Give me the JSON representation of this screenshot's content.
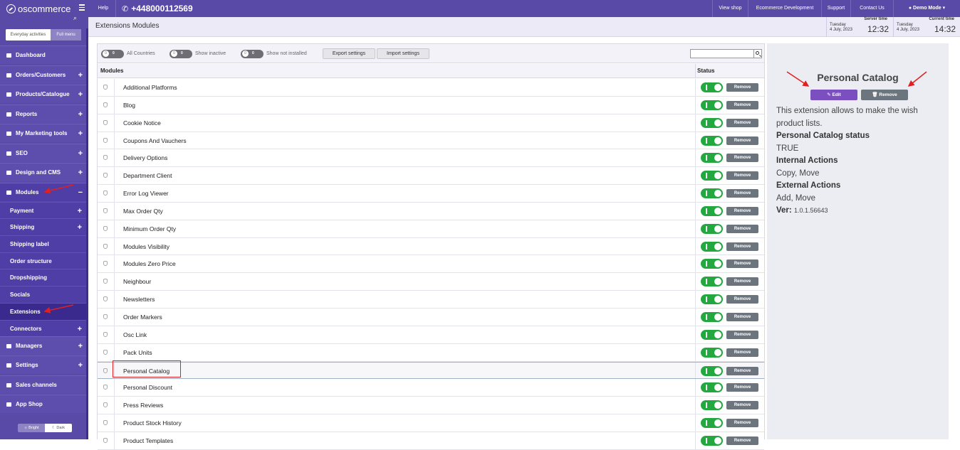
{
  "app": {
    "logo_text": "oscommerce"
  },
  "sidebar": {
    "modes": [
      "Everyday activities",
      "Full menu"
    ],
    "items": [
      {
        "label": "Dashboard",
        "icon": "dashboard-icon",
        "expand": ""
      },
      {
        "label": "Orders/Customers",
        "icon": "orders-icon",
        "expand": "+"
      },
      {
        "label": "Products/Catalogue",
        "icon": "catalogue-icon",
        "expand": "+"
      },
      {
        "label": "Reports",
        "icon": "reports-icon",
        "expand": "+"
      },
      {
        "label": "My Marketing tools",
        "icon": "marketing-icon",
        "expand": "+"
      },
      {
        "label": "SEO",
        "icon": "seo-icon",
        "expand": "+"
      },
      {
        "label": "Design and CMS",
        "icon": "design-icon",
        "expand": "+"
      },
      {
        "label": "Modules",
        "icon": "modules-icon",
        "expand": "−"
      }
    ],
    "subitems": [
      {
        "label": "Payment",
        "expand": "+"
      },
      {
        "label": "Shipping",
        "expand": "+"
      },
      {
        "label": "Shipping label",
        "expand": ""
      },
      {
        "label": "Order structure",
        "expand": ""
      },
      {
        "label": "Dropshipping",
        "expand": ""
      },
      {
        "label": "Socials",
        "expand": ""
      },
      {
        "label": "Extensions",
        "expand": ""
      },
      {
        "label": "Connectors",
        "expand": "+"
      }
    ],
    "bottom_items": [
      {
        "label": "Managers",
        "icon": "managers-icon",
        "expand": "+"
      },
      {
        "label": "Settings",
        "icon": "settings-icon",
        "expand": "+"
      },
      {
        "label": "Sales channels",
        "icon": "sales-channels-icon",
        "expand": ""
      },
      {
        "label": "App Shop",
        "icon": "app-shop-icon",
        "expand": ""
      }
    ],
    "theme": {
      "bright": "Bright",
      "dark": "Dark"
    }
  },
  "topbar": {
    "help": "Help",
    "phone": "+448000112569",
    "links": [
      "View shop",
      "Ecommerce Development",
      "Support",
      "Contact Us"
    ],
    "user": "Demo Mode"
  },
  "header": {
    "title": "Extensions Modules",
    "server_time": {
      "caption": "Server time",
      "day": "Tuesday",
      "date": "4 July, 2023",
      "time": "12:32"
    },
    "current_time": {
      "caption": "Current time",
      "day": "Tuesday",
      "date": "4 July, 2023",
      "time": "14:32"
    }
  },
  "filters": {
    "toggles": [
      "All Countries",
      "Show inactive",
      "Show not installed"
    ],
    "buttons": [
      "Export settings",
      "Import settings"
    ],
    "search_value": ""
  },
  "table": {
    "headers": [
      "Modules",
      "Status"
    ],
    "remove_label": "Remove",
    "selected": "Personal Catalog",
    "rows": [
      "Additional Platforms",
      "Blog",
      "Cookie Notice",
      "Coupons And Vauchers",
      "Delivery Options",
      "Department Client",
      "Error Log Viewer",
      "Max Order Qty",
      "Minimum Order Qty",
      "Modules Visibility",
      "Modules Zero Price",
      "Neighbour",
      "Newsletters",
      "Order Markers",
      "Osc Link",
      "Pack Units",
      "Personal Catalog",
      "Personal Discount",
      "Press Reviews",
      "Product Stock History",
      "Product Templates"
    ]
  },
  "info": {
    "title": "Personal Catalog",
    "edit": "Edit",
    "remove": "Remove",
    "description": "This extension allows to make the wish product lists.",
    "status_label": "Personal Catalog status",
    "status_value": "TRUE",
    "internal_label": "Internal Actions",
    "internal_value": "Copy, Move",
    "external_label": "External Actions",
    "external_value": "Add, Move",
    "ver_label": "Ver:",
    "ver_value": "1.0.1.56643"
  },
  "colors": {
    "brand": "#5a4aa8",
    "accent": "#7b4fc0",
    "toggle_on": "#23a840",
    "remove": "#6c757d",
    "annotation": "#e02020"
  }
}
